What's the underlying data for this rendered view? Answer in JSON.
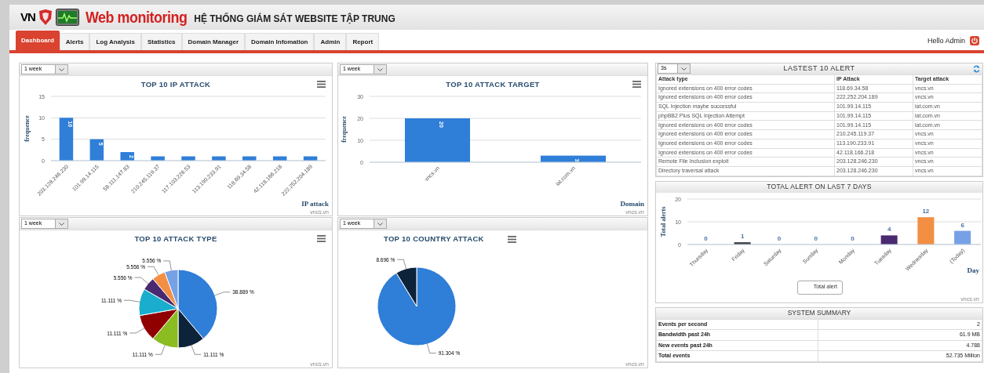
{
  "header": {
    "logo_text": "VN",
    "app_name": "Web monitoring",
    "subtitle": "HỆ THỐNG GIÁM SÁT WEBSITE TẬP TRUNG"
  },
  "tabs": [
    {
      "label": "Dashboard",
      "selected": true
    },
    {
      "label": "Alerts",
      "selected": false
    },
    {
      "label": "Log Analysis",
      "selected": false
    },
    {
      "label": "Statistics",
      "selected": false
    },
    {
      "label": "Domain Manager",
      "selected": false
    },
    {
      "label": "Domain Infomation",
      "selected": false
    },
    {
      "label": "Admin",
      "selected": false
    },
    {
      "label": "Report",
      "selected": false
    }
  ],
  "greeting": "Hello Admin",
  "charts": [
    {
      "range": "1 week",
      "credit": "vncs.vn",
      "chart_data": {
        "type": "bar",
        "title": "TOP 10 IP ATTACK",
        "xlabel": "IP attack",
        "ylabel": "frequence",
        "categories": [
          "203.128.246.230",
          "101.99.14.115",
          "58.111.147.83",
          "210.245.119.37",
          "117.103.228.53",
          "113.190.233.91",
          "118.69.34.58",
          "42.118.166.218",
          "222.252.204.189"
        ],
        "values": [
          10,
          5,
          2,
          1,
          1,
          1,
          1,
          1,
          1
        ],
        "ylim": [
          0,
          15
        ],
        "yticks": [
          0,
          5,
          10,
          15
        ],
        "value_labels": [
          "10",
          "5",
          "2",
          null,
          null,
          null,
          null,
          null,
          null
        ]
      }
    },
    {
      "range": "1 week",
      "credit": "vncs.vn",
      "chart_data": {
        "type": "bar",
        "title": "TOP 10 ATTACK TARGET",
        "xlabel": "Domain",
        "ylabel": "frequence",
        "categories": [
          "vncs.vn",
          "lat.com.vn"
        ],
        "values": [
          20,
          3
        ],
        "ylim": [
          0,
          30
        ],
        "yticks": [
          0,
          10,
          20,
          30
        ],
        "value_labels": [
          "20",
          "3"
        ]
      }
    },
    {
      "range": "1 week",
      "credit": "vncs.vn",
      "chart_data": {
        "type": "pie",
        "title": "TOP 10 ATTACK TYPE",
        "series": [
          {
            "values": [
              38.889,
              11.111,
              11.111,
              11.111,
              11.111,
              5.556,
              5.556,
              5.556
            ]
          }
        ],
        "value_labels": [
          "38.889 %",
          "11.111 %",
          "11.111 %",
          "11.111 %",
          "11.111 %",
          "5.556 %",
          "5.556 %",
          "5.556 %"
        ]
      }
    },
    {
      "range": "1 week",
      "credit": "vncs.vn",
      "chart_data": {
        "type": "pie",
        "title": "TOP 10 COUNTRY ATTACK",
        "series": [
          {
            "values": [
              91.304,
              8.696
            ]
          }
        ],
        "value_labels": [
          "91.304 %",
          "8.696 %"
        ]
      }
    }
  ],
  "latest_alerts": {
    "interval": "3s",
    "title": "LASTEST 10 ALERT",
    "columns": [
      "Attack type",
      "IP Attack",
      "Target attack"
    ],
    "rows": [
      [
        "Ignored extensions on 400 error codes",
        "118.69.34.58",
        "vncs.vn"
      ],
      [
        "Ignored extensions on 400 error codes",
        "222.252.204.189",
        "vncs.vn"
      ],
      [
        "SQL Injection maybe successful",
        "101.99.14.115",
        "lat.com.vn"
      ],
      [
        "phpBB2 Plus SQL Injection Attempt",
        "101.99.14.115",
        "lat.com.vn"
      ],
      [
        "Ignored extensions on 400 error codes",
        "101.99.14.115",
        "lat.com.vn"
      ],
      [
        "Ignored extensions on 400 error codes",
        "210.245.119.37",
        "vncs.vn"
      ],
      [
        "Ignored extensions on 400 error codes",
        "113.190.233.91",
        "vncs.vn"
      ],
      [
        "Ignored extensions on 400 error codes",
        "42.118.166.218",
        "vncs.vn"
      ],
      [
        "Remote File Inclusion exploit",
        "203.128.246.230",
        "vncs.vn"
      ],
      [
        "Directory traversal attack",
        "203.128.246.230",
        "vncs.vn"
      ]
    ]
  },
  "weekly_alerts": {
    "title": "TOTAL ALERT ON LAST 7 DAYS",
    "credit": "vncs.vn",
    "chart_data": {
      "type": "bar",
      "xlabel": "Day",
      "ylabel": "Total alerts",
      "categories": [
        "Thursday",
        "Friday",
        "Saturday",
        "Sunday",
        "Monday",
        "Tuesday",
        "Wednesday",
        "(Today)"
      ],
      "series": [
        {
          "name": "Total alert",
          "values": [
            0,
            1,
            0,
            0,
            0,
            4,
            12,
            6
          ]
        }
      ],
      "ylim": [
        0,
        20
      ],
      "yticks": [
        0,
        10,
        20
      ],
      "data_labels": true
    }
  },
  "system_summary": {
    "title": "SYSTEM SUMMARY",
    "rows": [
      {
        "label": "Events per second",
        "value": "2"
      },
      {
        "label": "Bandwidth past 24h",
        "value": "61.9 MB"
      },
      {
        "label": "New events past 24h",
        "value": "4.788"
      },
      {
        "label": "Total events",
        "value": "52.735 Million"
      }
    ]
  }
}
